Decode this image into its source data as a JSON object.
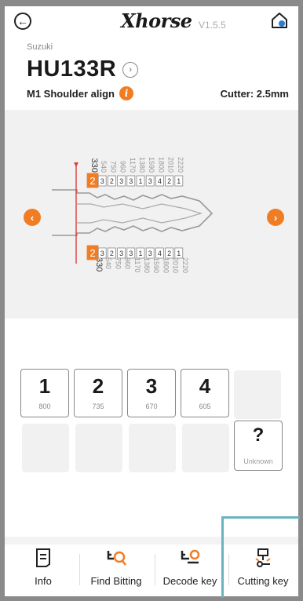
{
  "header": {
    "logo_text": "Xhorse",
    "version": "V1.5.5"
  },
  "key": {
    "brand": "Suzuki",
    "model": "HU133R",
    "mode": "M1  Shoulder align",
    "cutter": "Cutter: 2.5mm",
    "depth_positions": [
      "330",
      "540",
      "750",
      "960",
      "1170",
      "1380",
      "1590",
      "1800",
      "2010",
      "2220"
    ],
    "top_cuts": [
      "2",
      "3",
      "2",
      "3",
      "3",
      "1",
      "3",
      "4",
      "2",
      "1"
    ],
    "bottom_cuts": [
      "2",
      "3",
      "2",
      "3",
      "3",
      "1",
      "3",
      "4",
      "2",
      "1"
    ]
  },
  "depth_grid": [
    {
      "num": "1",
      "depth": "800"
    },
    {
      "num": "2",
      "depth": "735"
    },
    {
      "num": "3",
      "depth": "670"
    },
    {
      "num": "4",
      "depth": "605"
    }
  ],
  "unknown": {
    "symbol": "?",
    "label": "Unknown"
  },
  "bottom_nav": [
    {
      "label": "Info",
      "icon": "info-doc-icon"
    },
    {
      "label": "Find Bitting",
      "icon": "find-bitting-icon"
    },
    {
      "label": "Decode key",
      "icon": "decode-key-icon"
    },
    {
      "label": "Cutting key",
      "icon": "cutting-key-icon"
    }
  ],
  "colors": {
    "accent": "#f07d24",
    "guide": "#d9403a"
  }
}
